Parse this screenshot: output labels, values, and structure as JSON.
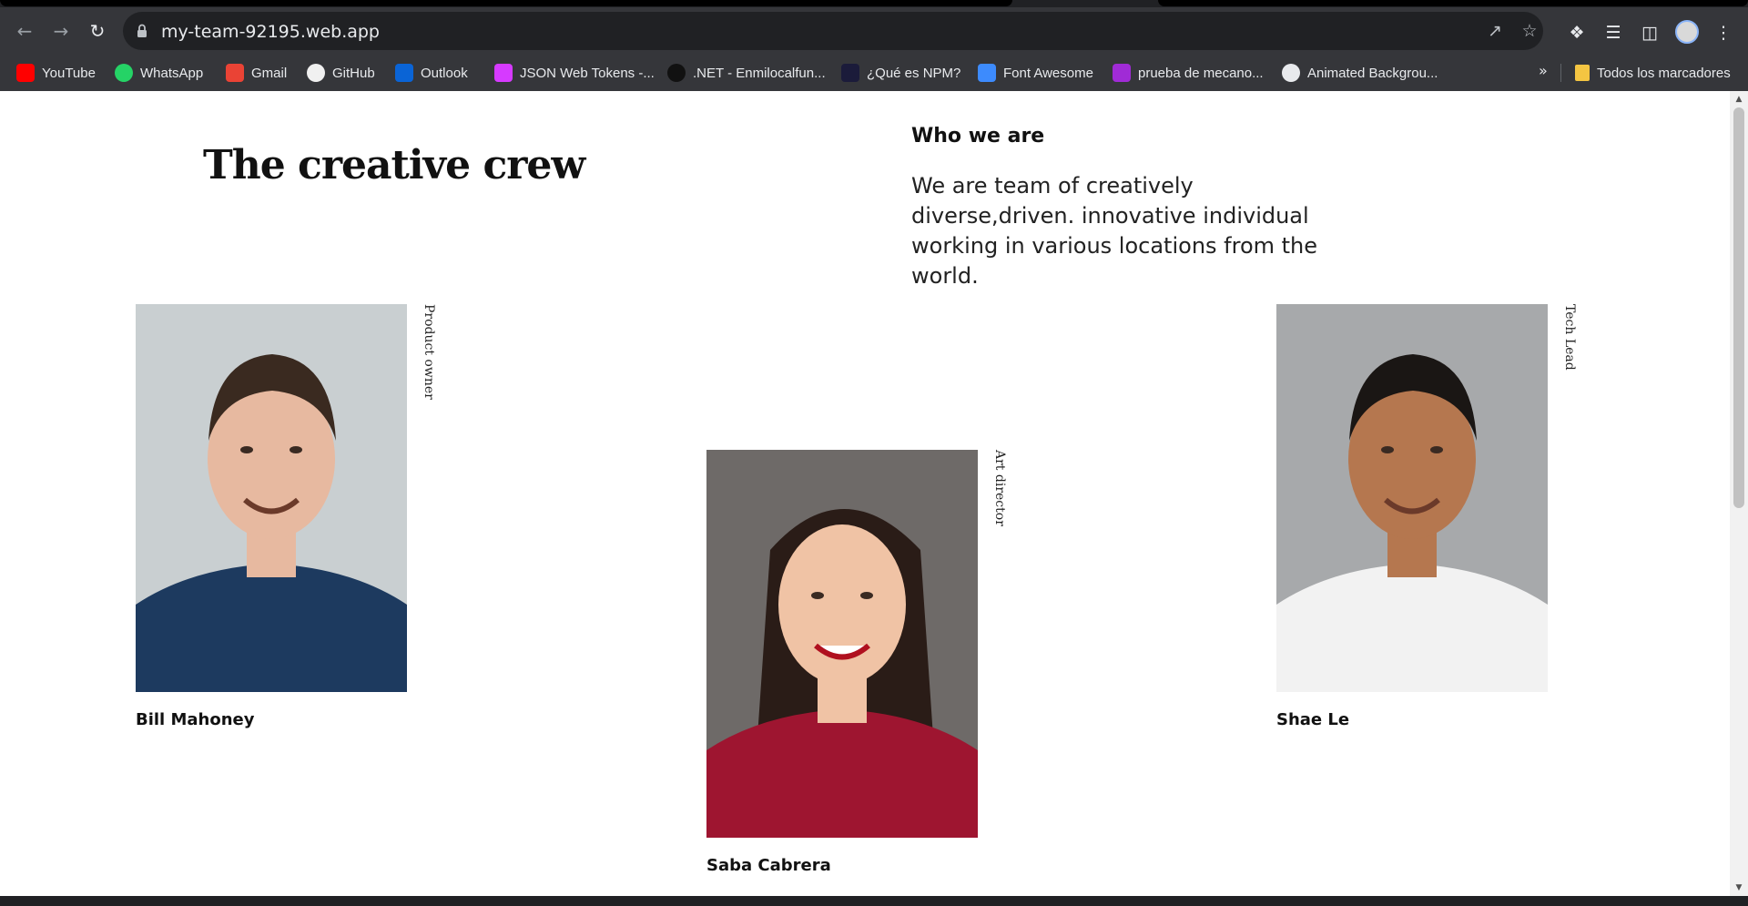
{
  "browser": {
    "url": "my-team-92195.web.app",
    "bookmarks": [
      {
        "label": "YouTube",
        "icon": "youtube-icon",
        "color": "#ff0000"
      },
      {
        "label": "WhatsApp",
        "icon": "whatsapp-icon",
        "color": "#25d366"
      },
      {
        "label": "Gmail",
        "icon": "gmail-icon",
        "color": "#ea4335"
      },
      {
        "label": "GitHub",
        "icon": "github-icon",
        "color": "#f0f0f0"
      },
      {
        "label": "Outlook",
        "icon": "outlook-icon",
        "color": "#0a64d6"
      },
      {
        "label": "JSON Web Tokens -...",
        "icon": "jwt-icon",
        "color": "#d63aff"
      },
      {
        "label": ".NET - Enmilocalfun...",
        "icon": "dotnet-icon",
        "color": "#111111"
      },
      {
        "label": "¿Qué es NPM?",
        "icon": "npm-icon",
        "color": "#1b1b3a"
      },
      {
        "label": "Font Awesome",
        "icon": "font-awesome-icon",
        "color": "#3d8bfd"
      },
      {
        "label": "prueba de mecano...",
        "icon": "typing-test-icon",
        "color": "#a02bd6"
      },
      {
        "label": "Animated Backgrou...",
        "icon": "globe-icon",
        "color": "#e8eaed"
      }
    ],
    "all_bookmarks_label": "Todos los marcadores"
  },
  "page": {
    "title": "The creative crew",
    "intro_heading": "Who we are",
    "intro_text": "We are team of creatively diverse,driven. innovative individual working in various locations from the world."
  },
  "team": [
    {
      "name": "Bill Mahoney",
      "role": "Product owner",
      "photo_colors": {
        "bg": "#c9cfd1",
        "shirt": "#1d3a5f",
        "skin": "#e7b9a0",
        "hair": "#3a2a20"
      }
    },
    {
      "name": "Saba Cabrera",
      "role": "Art director",
      "photo_colors": {
        "bg": "#6e6a68",
        "shirt": "#9e1530",
        "skin": "#f0c3a5",
        "hair": "#2a1c17"
      }
    },
    {
      "name": "Shae Le",
      "role": "Tech Lead",
      "photo_colors": {
        "bg": "#a7a9ab",
        "shirt": "#f2f2f2",
        "skin": "#b5774f",
        "hair": "#1a1614"
      }
    }
  ]
}
